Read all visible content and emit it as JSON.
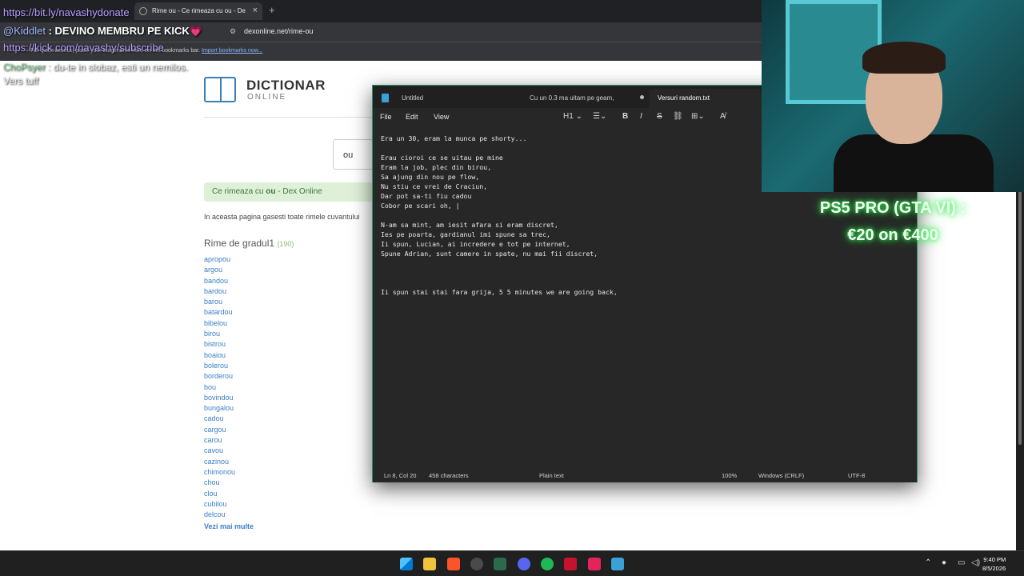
{
  "browser": {
    "tabs": [
      {
        "label": "Rime ou - Ce rimeaza cu ou - De",
        "active": true
      }
    ],
    "url": "dexonline.net/rime-ou",
    "bookmarks_text": "For quick access, place your bookmarks here on the bookmarks bar.",
    "bookmarks_link": "Import bookmarks now..."
  },
  "overlay": {
    "donate_link": "https://bit.ly/navashydonate",
    "kick_user": "@Kiddlet",
    "kick_text": ": DEVINO MEMBRU PE KICK💗",
    "subscribe_link": "https://kick.com/navashy/subscribe",
    "chat_user": "ChoPsyer",
    "chat_text": ": du-te in slobaz, esti un nemilos. Vers tuff",
    "promo_line1": "PS5 PRO (GTA VI) :",
    "promo_line2": "€20 on €400"
  },
  "page": {
    "logo_title": "DICTIONAR",
    "logo_subtitle": "ONLINE",
    "search_value": "ou",
    "banner_prefix": "Ce rimeaza cu ",
    "banner_bold": "ou",
    "banner_suffix": " - Dex Online",
    "intro": "In aceasta pagina gasesti toate rimele cuvantului",
    "rime_heading": "Rime de gradul1",
    "rime_count": "(190)",
    "words": [
      "apropou",
      "argou",
      "bandou",
      "bardou",
      "barou",
      "batardou",
      "bibelou",
      "birou",
      "bistrou",
      "boaiou",
      "bolerou",
      "borderou",
      "bou",
      "bovindou",
      "bungalou",
      "cadou",
      "cargou",
      "carou",
      "cavou",
      "cazinou",
      "chimonou",
      "chou",
      "clou",
      "cubilou",
      "delcou"
    ],
    "more": "Vezi mai multe"
  },
  "notepad": {
    "tabs": [
      "Untitled",
      "Cu un 0.3 ma uitam pe geam,",
      "Versuri random.txt"
    ],
    "menu": [
      "File",
      "Edit",
      "View"
    ],
    "heading_btn": "H1",
    "lines": [
      "Era un 30, eram la munca pe shorty...",
      "",
      "Erau cioroi ce se uitau pe mine",
      "Eram la job, plec din birou,",
      "Sa ajung din nou pe flow,",
      "Nu stiu ce vrei de Craciun,",
      "Dar pot sa-ti fiu cadou",
      "Cobor pe scari oh, |",
      "",
      "N-am sa mint, am iesit afara si eram discret,",
      "Ies pe poarta, gardianul imi spune sa trec,",
      "Ii spun, Lucian, ai incredere e tot pe internet,",
      "Spune Adrian, sunt camere in spate, nu mai fii discret,",
      "",
      "",
      "",
      "Ii spun stai stai fara grija, 5 5 minutes we are going back,"
    ],
    "status": {
      "position": "Ln 8, Col 20",
      "chars": "458 characters",
      "format": "Plain text",
      "zoom": "100%",
      "line_ending": "Windows (CRLF)",
      "encoding": "UTF-8"
    }
  },
  "taskbar": {
    "time": "9:40 PM",
    "date": "8/5/2026"
  }
}
